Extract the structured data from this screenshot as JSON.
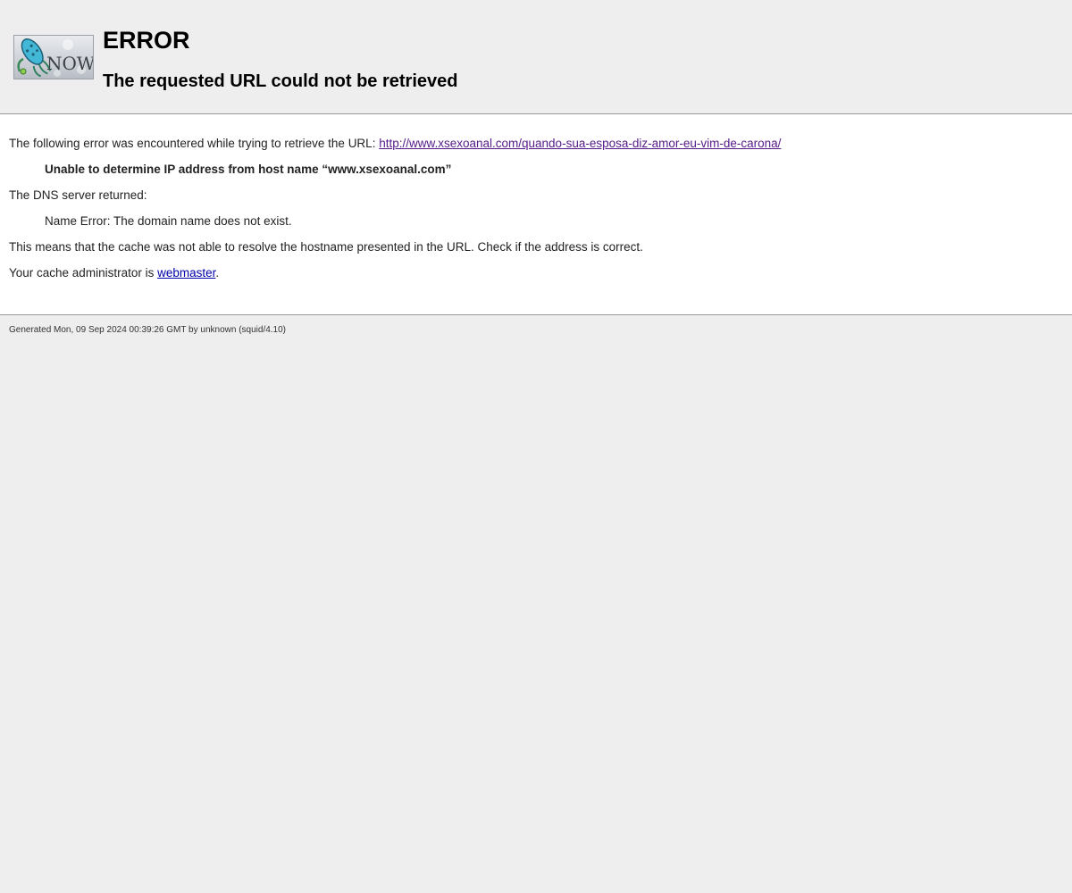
{
  "header": {
    "logo_text": "NOW",
    "title": "ERROR",
    "subtitle": "The requested URL could not be retrieved"
  },
  "content": {
    "intro_prefix": "The following error was encountered while trying to retrieve the URL: ",
    "url": "http://www.xsexoanal.com/quando-sua-esposa-diz-amor-eu-vim-de-carona/",
    "error_message": "Unable to determine IP address from host name “www.xsexoanal.com”",
    "dns_label": "The DNS server returned:",
    "dns_error": "Name Error: The domain name does not exist.",
    "explanation": "This means that the cache was not able to resolve the hostname presented in the URL. Check if the address is correct.",
    "admin_prefix": "Your cache administrator is ",
    "admin_link": "webmaster",
    "admin_suffix": "."
  },
  "footer": {
    "generated": "Generated Mon, 09 Sep 2024 00:39:26 GMT by unknown (squid/4.10)"
  },
  "colors": {
    "page_background": "#eeeeee",
    "content_background": "#ffffff",
    "visited_link": "#551a8b",
    "link": "#0000aa"
  }
}
